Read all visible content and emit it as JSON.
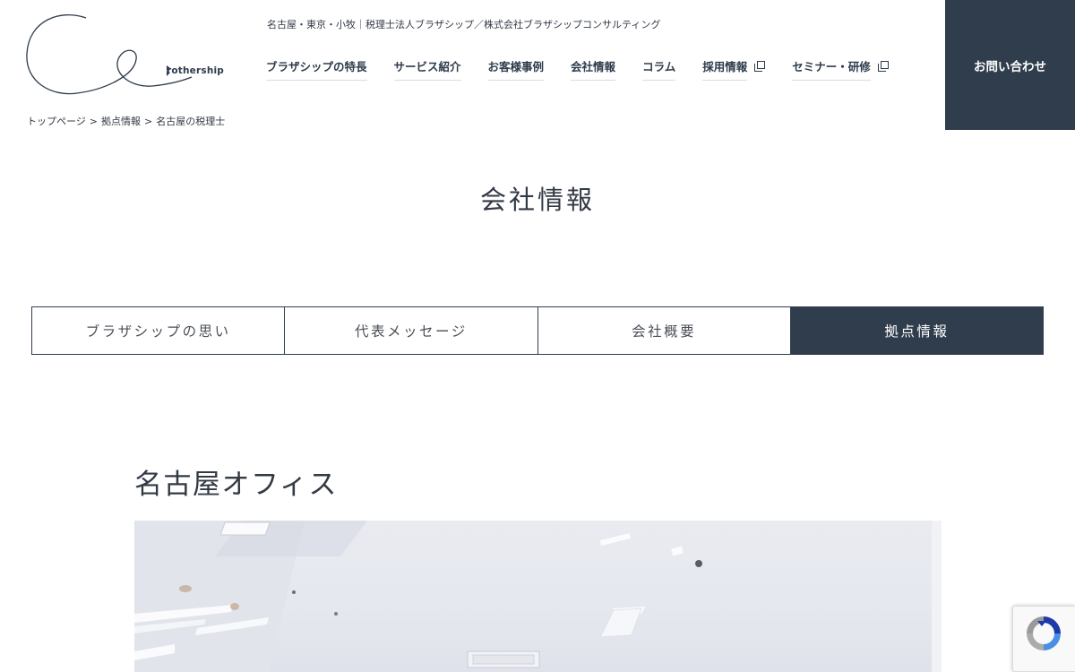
{
  "header": {
    "logo_text": "rothership",
    "tagline": "名古屋・東京・小牧｜税理士法人ブラザシップ／株式会社ブラザシップコンサルティング",
    "nav": [
      {
        "label": "ブラザシップの特長",
        "external": false
      },
      {
        "label": "サービス紹介",
        "external": false
      },
      {
        "label": "お客様事例",
        "external": false
      },
      {
        "label": "会社情報",
        "external": false
      },
      {
        "label": "コラム",
        "external": false
      },
      {
        "label": "採用情報",
        "external": true
      },
      {
        "label": "セミナー・研修",
        "external": true
      }
    ],
    "contact_label": "お問い合わせ"
  },
  "breadcrumb": {
    "items": [
      "トップページ",
      "拠点情報",
      "名古屋の税理士"
    ],
    "separator": ">"
  },
  "page_title": "会社情報",
  "tabs": [
    {
      "label": "ブラザシップの思い",
      "active": false
    },
    {
      "label": "代表メッセージ",
      "active": false
    },
    {
      "label": "会社概要",
      "active": false
    },
    {
      "label": "拠点情報",
      "active": true
    }
  ],
  "section": {
    "title": "名古屋オフィス"
  },
  "icons": {
    "external_link": "external-link-icon",
    "recaptcha": "recaptcha-icon"
  },
  "colors": {
    "navy": "#2f3d4c",
    "text": "#333a45",
    "white": "#ffffff"
  }
}
